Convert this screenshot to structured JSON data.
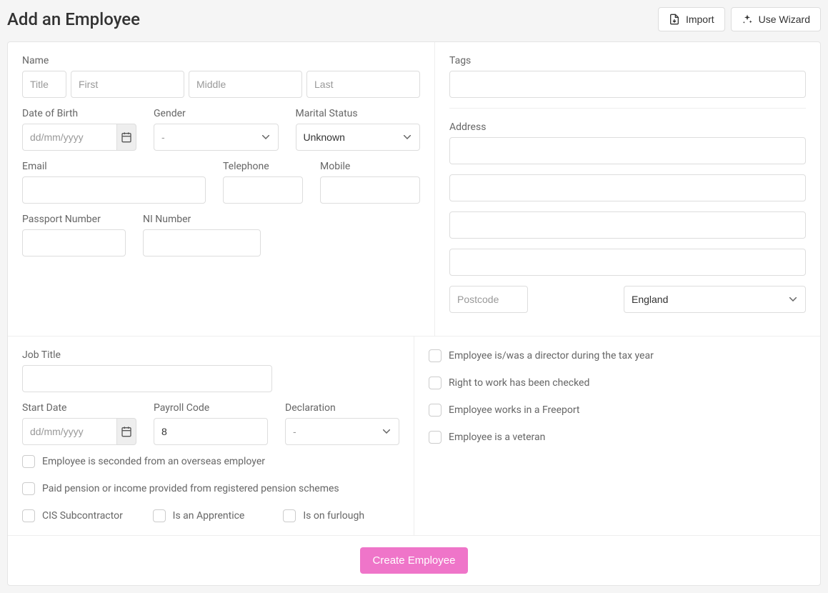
{
  "header": {
    "title": "Add an Employee",
    "import_button": "Import",
    "wizard_button": "Use Wizard"
  },
  "name_section": {
    "label": "Name",
    "title_placeholder": "Title",
    "first_placeholder": "First",
    "middle_placeholder": "Middle",
    "last_placeholder": "Last"
  },
  "personal": {
    "dob_label": "Date of Birth",
    "dob_placeholder": "dd/mm/yyyy",
    "gender_label": "Gender",
    "gender_value": "-",
    "marital_label": "Marital Status",
    "marital_value": "Unknown",
    "email_label": "Email",
    "telephone_label": "Telephone",
    "mobile_label": "Mobile",
    "passport_label": "Passport Number",
    "ni_label": "NI Number"
  },
  "tags": {
    "label": "Tags"
  },
  "address": {
    "label": "Address",
    "postcode_placeholder": "Postcode",
    "country_value": "England"
  },
  "job": {
    "title_label": "Job Title",
    "start_date_label": "Start Date",
    "start_date_placeholder": "dd/mm/yyyy",
    "payroll_code_label": "Payroll Code",
    "payroll_code_value": "8",
    "declaration_label": "Declaration",
    "declaration_value": "-"
  },
  "checkboxes_left": {
    "seconded": "Employee is seconded from an overseas employer",
    "pension": "Paid pension or income provided from registered pension schemes",
    "cis": "CIS Subcontractor",
    "apprentice": "Is an Apprentice",
    "furlough": "Is on furlough"
  },
  "checkboxes_right": {
    "director": "Employee is/was a director during the tax year",
    "right_to_work": "Right to work has been checked",
    "freeport": "Employee works in a Freeport",
    "veteran": "Employee is a veteran"
  },
  "footer": {
    "create_button": "Create Employee"
  }
}
